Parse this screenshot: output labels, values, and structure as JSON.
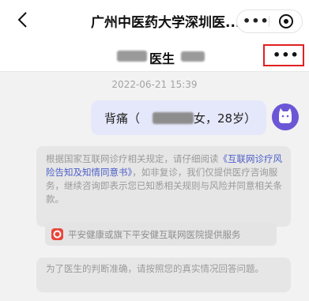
{
  "header": {
    "title": "广州中医药大学深圳医...",
    "back_icon": "chevron-left-icon",
    "more_icon": "more-dots-icon",
    "close_icon": "target-circle-icon"
  },
  "doctor": {
    "name_suffix": "医生",
    "more_label": "•••",
    "highlight_color": "#e02020"
  },
  "chat": {
    "timestamp": "2022-06-21 15:39",
    "patient_message_prefix": "背痛（",
    "patient_message_suffix": "女，28岁）",
    "bubble_color": "#e5e8fa",
    "avatar_color": "#6b57d6"
  },
  "notice": {
    "text_before": "根据国家互联网诊疗相关规定，请仔细阅读",
    "link": "《互联网诊疗风险告知及知情同意书》",
    "text_after": "，如非复诊，我们仅提供医疗咨询服务，继续咨询即表示您已知悉相关规则与风险并同意相关条款。",
    "link_color": "#4d5fc9"
  },
  "provider": {
    "text": "平安健康或旗下平安健互联网医院提供服务",
    "logo_color": "#e8463b"
  },
  "prompt": {
    "text": "为了医生的判断准确，请按照您的真实情况回答问题。"
  }
}
